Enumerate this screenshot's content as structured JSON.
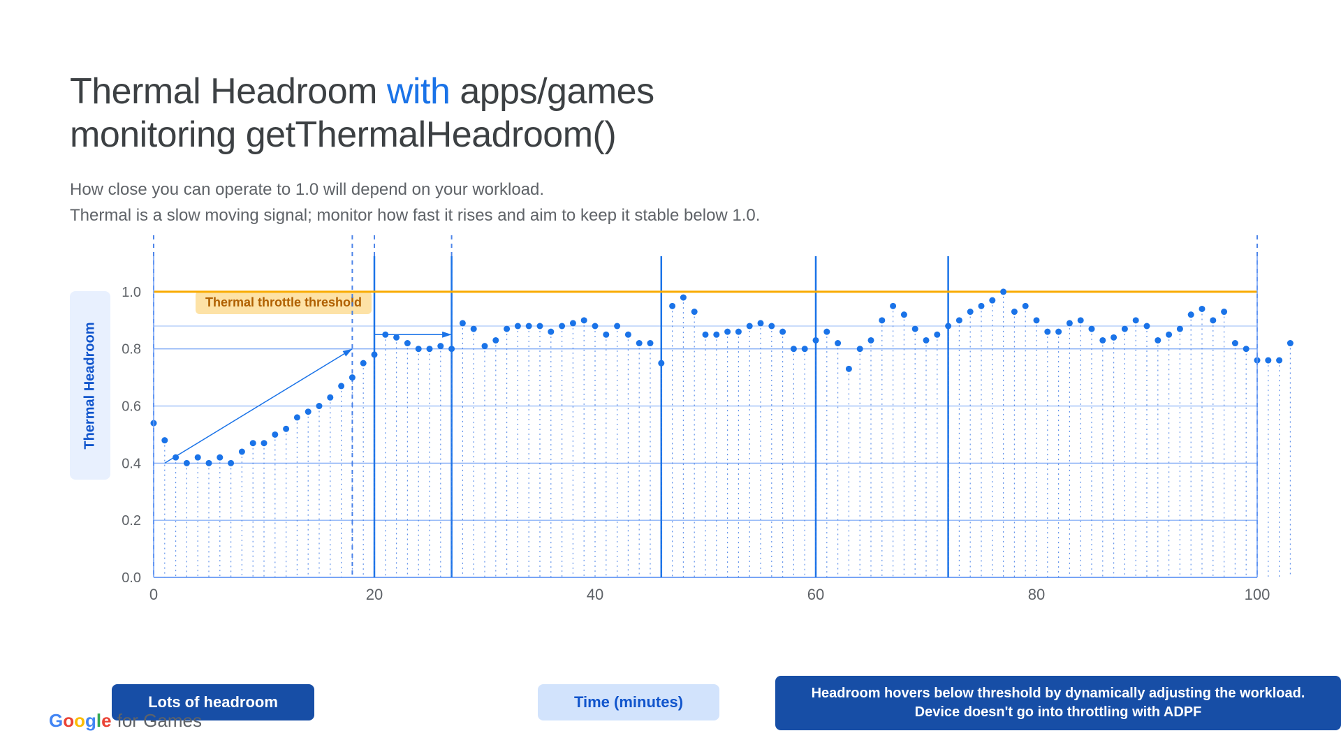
{
  "title": {
    "p1": "Thermal Headroom ",
    "accent": "with",
    "p2": " apps/games",
    "line2": "monitoring getThermalHeadroom()"
  },
  "subtitle": {
    "l1": "How close you can operate to 1.0 will depend on your workload.",
    "l2": "Thermal is a slow moving signal; monitor how fast it rises and aim to keep it stable below 1.0."
  },
  "threshold_label": "Thermal throttle threshold",
  "ylabel": "Thermal Headroom",
  "xlabel": "Time (minutes)",
  "lots_label": "Lots of headroom",
  "hover_label": "Headroom hovers below threshold by dynamically adjusting the workload. Device doesn't go into throttling with ADPF",
  "footer": {
    "prefix": "",
    "brand": "Google",
    "suffix": " for Games"
  },
  "chart_data": {
    "type": "scatter",
    "title": "Thermal Headroom with apps/games monitoring getThermalHeadroom()",
    "xlabel": "Time (minutes)",
    "ylabel": "Thermal Headroom",
    "xlim": [
      0,
      100
    ],
    "ylim": [
      0.0,
      1.0
    ],
    "xticks": [
      0,
      20,
      40,
      60,
      80,
      100
    ],
    "yticks": [
      0.0,
      0.2,
      0.4,
      0.6,
      0.8,
      1.0
    ],
    "threshold": 1.0,
    "secondary_line": 0.88,
    "vertical_dashed_lines": [
      0,
      18,
      20,
      27,
      100
    ],
    "vertical_solid_lines": [
      20,
      27,
      46,
      60,
      72
    ],
    "trend_arrows": [
      [
        1,
        0.4,
        18,
        0.8
      ],
      [
        20,
        0.85,
        27,
        0.85
      ]
    ],
    "values": [
      0.54,
      0.48,
      0.42,
      0.4,
      0.42,
      0.4,
      0.42,
      0.4,
      0.44,
      0.47,
      0.47,
      0.5,
      0.52,
      0.56,
      0.58,
      0.6,
      0.63,
      0.67,
      0.7,
      0.75,
      0.78,
      0.85,
      0.84,
      0.82,
      0.8,
      0.8,
      0.81,
      0.8,
      0.89,
      0.87,
      0.81,
      0.83,
      0.87,
      0.88,
      0.88,
      0.88,
      0.86,
      0.88,
      0.89,
      0.9,
      0.88,
      0.85,
      0.88,
      0.85,
      0.82,
      0.82,
      0.75,
      0.95,
      0.98,
      0.93,
      0.85,
      0.85,
      0.86,
      0.86,
      0.88,
      0.89,
      0.88,
      0.86,
      0.8,
      0.8,
      0.83,
      0.86,
      0.82,
      0.73,
      0.8,
      0.83,
      0.9,
      0.95,
      0.92,
      0.87,
      0.83,
      0.85,
      0.88,
      0.9,
      0.93,
      0.95,
      0.97,
      1.0,
      0.93,
      0.95,
      0.9,
      0.86,
      0.86,
      0.89,
      0.9,
      0.87,
      0.83,
      0.84,
      0.87,
      0.9,
      0.88,
      0.83,
      0.85,
      0.87,
      0.92,
      0.94,
      0.9,
      0.93,
      0.82,
      0.8,
      0.76,
      0.76,
      0.76,
      0.82
    ]
  },
  "colors": {
    "logo": [
      "#4285F4",
      "#EA4335",
      "#FBBC05",
      "#4285F4",
      "#34A853",
      "#EA4335"
    ]
  }
}
